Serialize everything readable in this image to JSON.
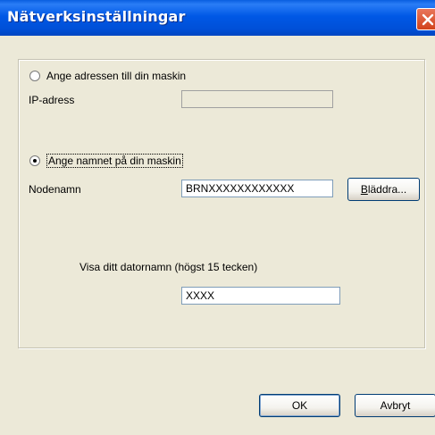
{
  "window": {
    "title": "Nätverksinställningar"
  },
  "address_option": {
    "label": "Ange adressen till din maskin",
    "ip_label": "IP-adress",
    "ip_value": ""
  },
  "name_option": {
    "label": "Ange namnet på din maskin",
    "node_label": "Nodenamn",
    "node_value": "BRNXXXXXXXXXXXX",
    "browse_hotkey": "B",
    "browse_rest": "läddra..."
  },
  "computer_name": {
    "label": "Visa ditt datornamn (högst 15 tecken)",
    "value": "XXXX"
  },
  "buttons": {
    "ok": "OK",
    "cancel": "Avbryt"
  }
}
